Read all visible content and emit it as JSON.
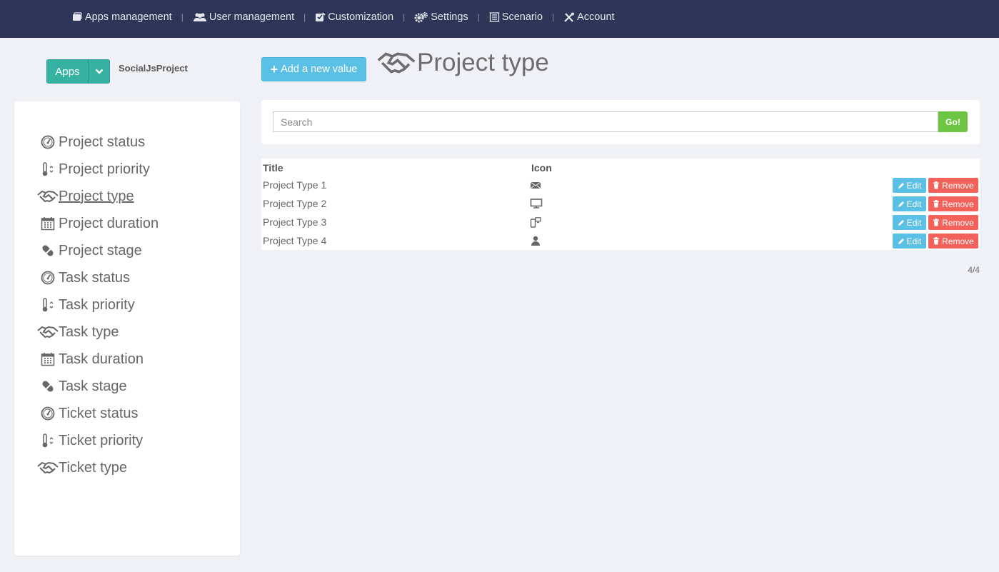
{
  "nav": {
    "items": [
      {
        "label": "Apps management",
        "icon": "apps-icon"
      },
      {
        "label": "User management",
        "icon": "users-icon"
      },
      {
        "label": "Customization",
        "icon": "customization-icon"
      },
      {
        "label": "Settings",
        "icon": "gears-icon"
      },
      {
        "label": "Scenario",
        "icon": "list-icon"
      },
      {
        "label": "Account",
        "icon": "tools-icon"
      }
    ],
    "separator": "|"
  },
  "apps_dropdown": {
    "label": "Apps",
    "caret_icon": "chevron-down-icon"
  },
  "project_name": "SocialJsProject",
  "sidebar": {
    "items": [
      {
        "label": "Project status",
        "icon": "dashboard-icon"
      },
      {
        "label": "Project priority",
        "icon": "thermometer-icon"
      },
      {
        "label": "Project type",
        "icon": "handshake-icon",
        "active": true
      },
      {
        "label": "Project duration",
        "icon": "calendar-icon"
      },
      {
        "label": "Project stage",
        "icon": "pill-icon"
      },
      {
        "label": "Task status",
        "icon": "dashboard-icon"
      },
      {
        "label": "Task priority",
        "icon": "thermometer-icon"
      },
      {
        "label": "Task type",
        "icon": "handshake-icon"
      },
      {
        "label": "Task duration",
        "icon": "calendar-icon"
      },
      {
        "label": "Task stage",
        "icon": "pill-icon"
      },
      {
        "label": "Ticket status",
        "icon": "dashboard-icon"
      },
      {
        "label": "Ticket priority",
        "icon": "thermometer-icon"
      },
      {
        "label": "Ticket type",
        "icon": "handshake-icon"
      }
    ]
  },
  "main": {
    "add_button": "Add a new value",
    "title": "Project type",
    "title_icon": "handshake-icon",
    "search": {
      "placeholder": "Search",
      "value": "",
      "go_label": "Go!"
    },
    "table": {
      "headers": {
        "title": "Title",
        "icon": "Icon"
      },
      "rows": [
        {
          "title": "Project Type 1",
          "icon": "envelope-icon"
        },
        {
          "title": "Project Type 2",
          "icon": "monitor-icon"
        },
        {
          "title": "Project Type 3",
          "icon": "devices-icon"
        },
        {
          "title": "Project Type 4",
          "icon": "user-icon"
        }
      ],
      "edit_label": "Edit",
      "remove_label": "Remove"
    },
    "pager": "4/4"
  },
  "colors": {
    "topbar": "#2e3556",
    "apps_button": "#37b2a2",
    "add_button": "#5bc0e6",
    "go_button": "#6cc644",
    "remove_button": "#f2625a"
  }
}
